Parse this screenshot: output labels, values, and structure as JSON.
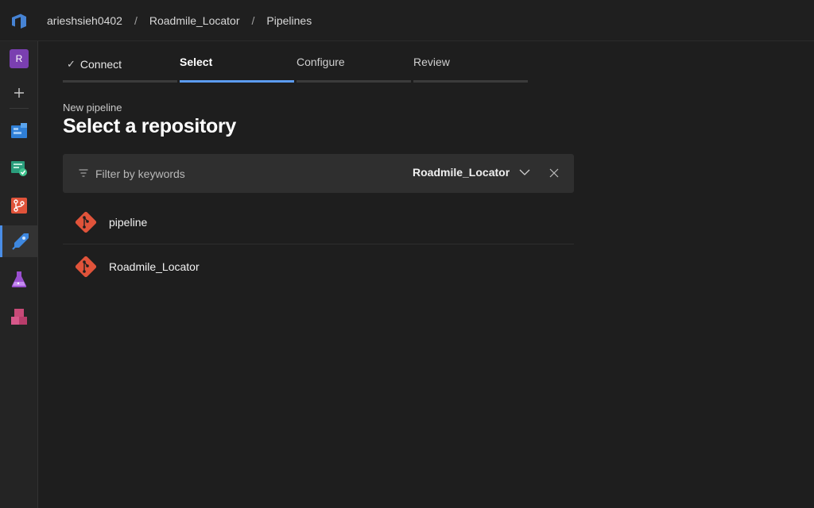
{
  "breadcrumb": {
    "org": "arieshsieh0402",
    "project": "Roadmile_Locator",
    "page": "Pipelines",
    "separator": "/"
  },
  "leftnav": {
    "avatar_letter": "R",
    "items": [
      "project-avatar",
      "add",
      "boards",
      "test-plans-check",
      "repos",
      "pipelines",
      "test-plans",
      "artifacts"
    ]
  },
  "wizard": {
    "steps": [
      {
        "label": "Connect",
        "state": "done"
      },
      {
        "label": "Select",
        "state": "active"
      },
      {
        "label": "Configure",
        "state": "upcoming"
      },
      {
        "label": "Review",
        "state": "upcoming"
      }
    ]
  },
  "header": {
    "subtitle": "New pipeline",
    "title": "Select a repository"
  },
  "filter": {
    "placeholder": "Filter by keywords",
    "selected_repo": "Roadmile_Locator"
  },
  "repos": [
    {
      "name": "pipeline"
    },
    {
      "name": "Roadmile_Locator"
    }
  ],
  "colors": {
    "accent": "#5b9bf0",
    "git": "#e0533a",
    "background": "#1e1e1e"
  }
}
